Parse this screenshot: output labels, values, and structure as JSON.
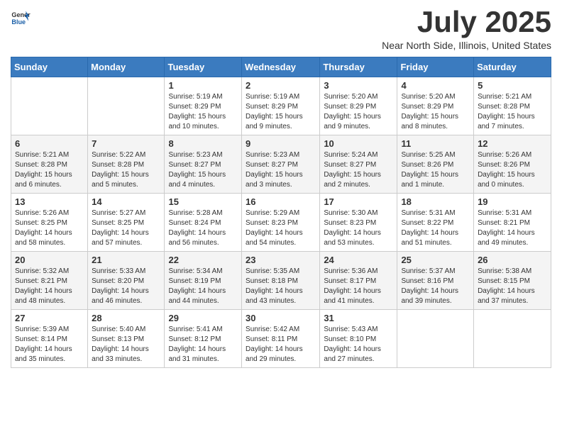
{
  "logo": {
    "general": "General",
    "blue": "Blue"
  },
  "title": {
    "month": "July 2025",
    "location": "Near North Side, Illinois, United States"
  },
  "weekdays": [
    "Sunday",
    "Monday",
    "Tuesday",
    "Wednesday",
    "Thursday",
    "Friday",
    "Saturday"
  ],
  "weeks": [
    [
      {
        "day": "",
        "info": ""
      },
      {
        "day": "",
        "info": ""
      },
      {
        "day": "1",
        "info": "Sunrise: 5:19 AM\nSunset: 8:29 PM\nDaylight: 15 hours\nand 10 minutes."
      },
      {
        "day": "2",
        "info": "Sunrise: 5:19 AM\nSunset: 8:29 PM\nDaylight: 15 hours\nand 9 minutes."
      },
      {
        "day": "3",
        "info": "Sunrise: 5:20 AM\nSunset: 8:29 PM\nDaylight: 15 hours\nand 9 minutes."
      },
      {
        "day": "4",
        "info": "Sunrise: 5:20 AM\nSunset: 8:29 PM\nDaylight: 15 hours\nand 8 minutes."
      },
      {
        "day": "5",
        "info": "Sunrise: 5:21 AM\nSunset: 8:28 PM\nDaylight: 15 hours\nand 7 minutes."
      }
    ],
    [
      {
        "day": "6",
        "info": "Sunrise: 5:21 AM\nSunset: 8:28 PM\nDaylight: 15 hours\nand 6 minutes."
      },
      {
        "day": "7",
        "info": "Sunrise: 5:22 AM\nSunset: 8:28 PM\nDaylight: 15 hours\nand 5 minutes."
      },
      {
        "day": "8",
        "info": "Sunrise: 5:23 AM\nSunset: 8:27 PM\nDaylight: 15 hours\nand 4 minutes."
      },
      {
        "day": "9",
        "info": "Sunrise: 5:23 AM\nSunset: 8:27 PM\nDaylight: 15 hours\nand 3 minutes."
      },
      {
        "day": "10",
        "info": "Sunrise: 5:24 AM\nSunset: 8:27 PM\nDaylight: 15 hours\nand 2 minutes."
      },
      {
        "day": "11",
        "info": "Sunrise: 5:25 AM\nSunset: 8:26 PM\nDaylight: 15 hours\nand 1 minute."
      },
      {
        "day": "12",
        "info": "Sunrise: 5:26 AM\nSunset: 8:26 PM\nDaylight: 15 hours\nand 0 minutes."
      }
    ],
    [
      {
        "day": "13",
        "info": "Sunrise: 5:26 AM\nSunset: 8:25 PM\nDaylight: 14 hours\nand 58 minutes."
      },
      {
        "day": "14",
        "info": "Sunrise: 5:27 AM\nSunset: 8:25 PM\nDaylight: 14 hours\nand 57 minutes."
      },
      {
        "day": "15",
        "info": "Sunrise: 5:28 AM\nSunset: 8:24 PM\nDaylight: 14 hours\nand 56 minutes."
      },
      {
        "day": "16",
        "info": "Sunrise: 5:29 AM\nSunset: 8:23 PM\nDaylight: 14 hours\nand 54 minutes."
      },
      {
        "day": "17",
        "info": "Sunrise: 5:30 AM\nSunset: 8:23 PM\nDaylight: 14 hours\nand 53 minutes."
      },
      {
        "day": "18",
        "info": "Sunrise: 5:31 AM\nSunset: 8:22 PM\nDaylight: 14 hours\nand 51 minutes."
      },
      {
        "day": "19",
        "info": "Sunrise: 5:31 AM\nSunset: 8:21 PM\nDaylight: 14 hours\nand 49 minutes."
      }
    ],
    [
      {
        "day": "20",
        "info": "Sunrise: 5:32 AM\nSunset: 8:21 PM\nDaylight: 14 hours\nand 48 minutes."
      },
      {
        "day": "21",
        "info": "Sunrise: 5:33 AM\nSunset: 8:20 PM\nDaylight: 14 hours\nand 46 minutes."
      },
      {
        "day": "22",
        "info": "Sunrise: 5:34 AM\nSunset: 8:19 PM\nDaylight: 14 hours\nand 44 minutes."
      },
      {
        "day": "23",
        "info": "Sunrise: 5:35 AM\nSunset: 8:18 PM\nDaylight: 14 hours\nand 43 minutes."
      },
      {
        "day": "24",
        "info": "Sunrise: 5:36 AM\nSunset: 8:17 PM\nDaylight: 14 hours\nand 41 minutes."
      },
      {
        "day": "25",
        "info": "Sunrise: 5:37 AM\nSunset: 8:16 PM\nDaylight: 14 hours\nand 39 minutes."
      },
      {
        "day": "26",
        "info": "Sunrise: 5:38 AM\nSunset: 8:15 PM\nDaylight: 14 hours\nand 37 minutes."
      }
    ],
    [
      {
        "day": "27",
        "info": "Sunrise: 5:39 AM\nSunset: 8:14 PM\nDaylight: 14 hours\nand 35 minutes."
      },
      {
        "day": "28",
        "info": "Sunrise: 5:40 AM\nSunset: 8:13 PM\nDaylight: 14 hours\nand 33 minutes."
      },
      {
        "day": "29",
        "info": "Sunrise: 5:41 AM\nSunset: 8:12 PM\nDaylight: 14 hours\nand 31 minutes."
      },
      {
        "day": "30",
        "info": "Sunrise: 5:42 AM\nSunset: 8:11 PM\nDaylight: 14 hours\nand 29 minutes."
      },
      {
        "day": "31",
        "info": "Sunrise: 5:43 AM\nSunset: 8:10 PM\nDaylight: 14 hours\nand 27 minutes."
      },
      {
        "day": "",
        "info": ""
      },
      {
        "day": "",
        "info": ""
      }
    ]
  ]
}
